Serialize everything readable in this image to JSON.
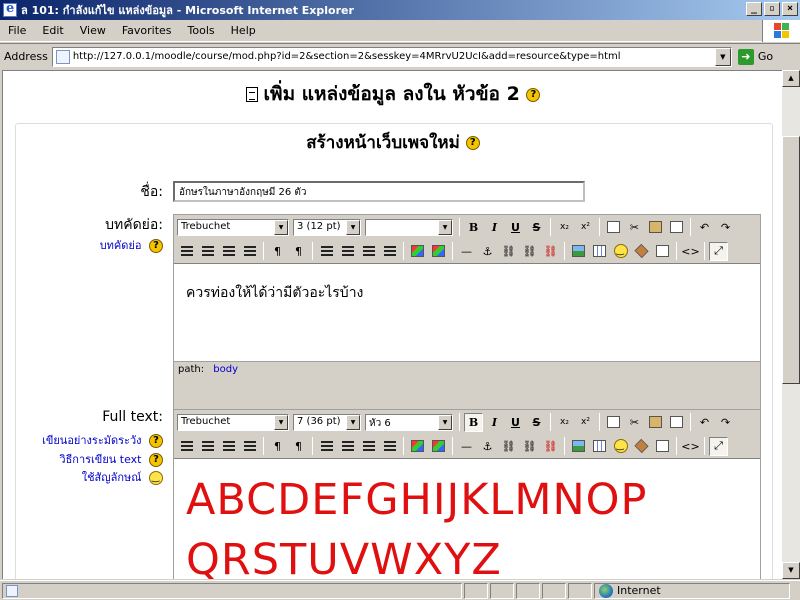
{
  "window": {
    "title": "ล 101: กำลังแก้ไข แหล่งข้อมูล - Microsoft Internet Explorer",
    "minimize": "_",
    "maximize": "▫",
    "close": "×"
  },
  "menubar": {
    "items": [
      "File",
      "Edit",
      "View",
      "Favorites",
      "Tools",
      "Help"
    ]
  },
  "address": {
    "label": "Address",
    "url": "http://127.0.0.1/moodle/course/mod.php?id=2&section=2&sesskey=4MRrvU2UcI&add=resource&type=html",
    "go_label": "Go"
  },
  "page": {
    "heading": "เพิ่ม แหล่งข้อมูล ลงใน หัวข้อ 2",
    "form_heading": "สร้างหน้าเว็บเพจใหม่",
    "name_label": "ชื่อ:",
    "name_value": "อักษรในภาษาอังกฤษมี 26 ตัว",
    "summary_label": "บทคัดย่อ:",
    "summary_link": "บทคัดย่อ",
    "summary_text": "ควรท่องให้ได้ว่ามีตัวอะไรบ้าง",
    "fulltext_label": "Full text:",
    "fulltext_links": [
      "เขียนอย่างระมัดระวัง",
      "วิธีการเขียน text",
      "ใช้สัญลักษณ์"
    ],
    "fulltext_line1": "ABCDEFGHIJKLMNOP",
    "fulltext_line2": "QRSTUVWXYZ"
  },
  "editor_summary": {
    "font": "Trebuchet",
    "size": "3 (12 pt)",
    "format": "",
    "path_label": "path:",
    "path_value": "body"
  },
  "editor_full": {
    "font": "Trebuchet",
    "size": "7 (36 pt)",
    "format": "หัว 6"
  },
  "toolbar": {
    "bold": "B",
    "italic": "I",
    "underline": "U",
    "strike": "S",
    "subscript": "x₂",
    "superscript": "x²",
    "undo": "↶",
    "redo": "↷",
    "ltr": "¶",
    "rtl": "¶",
    "hr": "—",
    "anchor": "⚓",
    "html": "<>",
    "fullscreen": "⤢"
  },
  "help_glyph": "?",
  "status": {
    "zone": "Internet"
  }
}
